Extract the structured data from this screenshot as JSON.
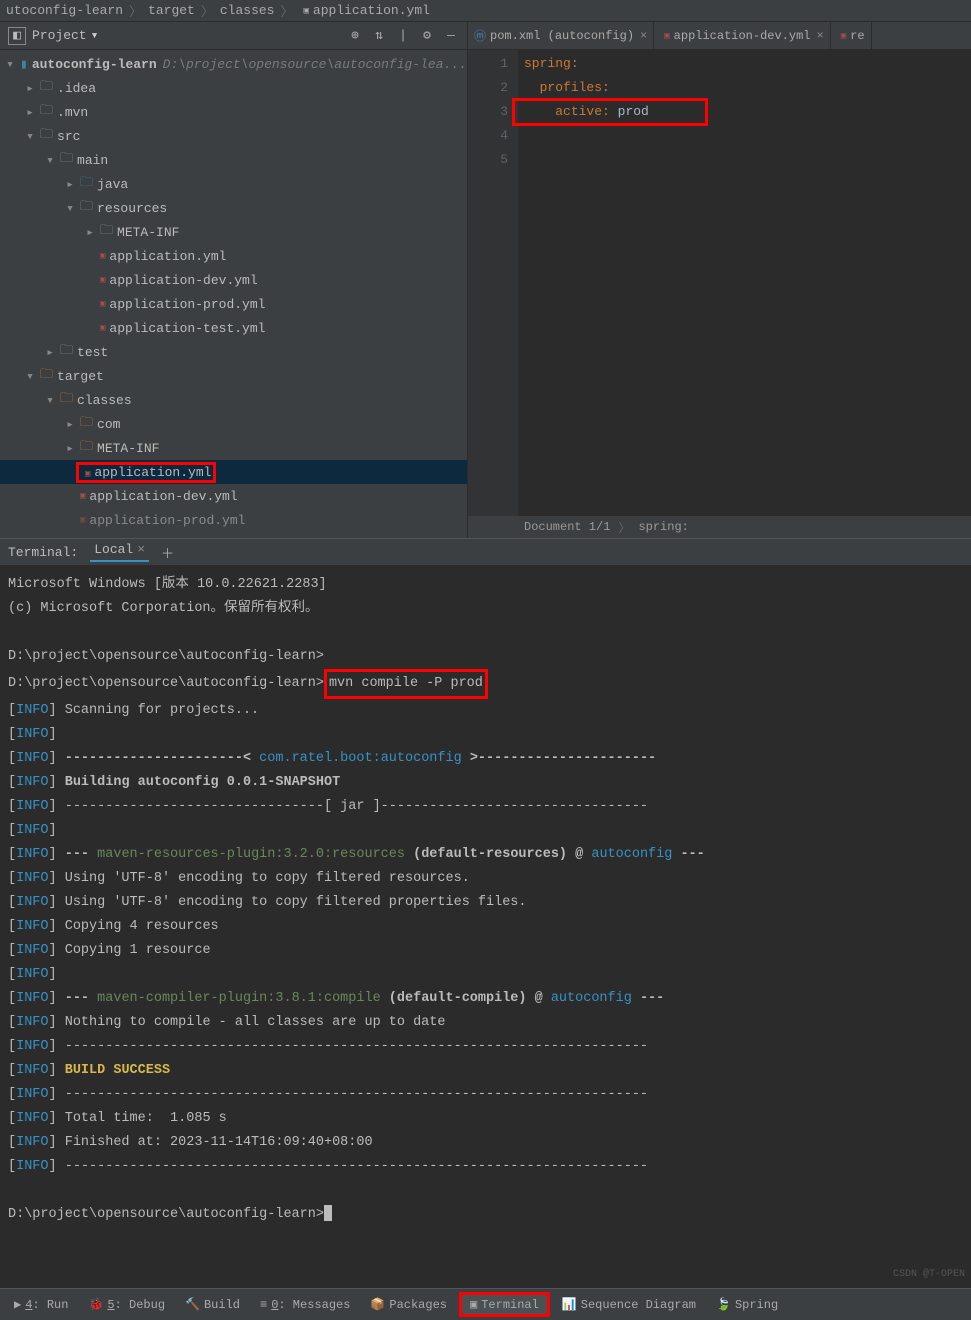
{
  "breadcrumb": {
    "items": [
      "utoconfig-learn",
      "target",
      "classes",
      "application.yml"
    ]
  },
  "project": {
    "title": "Project",
    "root": {
      "name": "autoconfig-learn",
      "path": "D:\\project\\opensource\\autoconfig-lea..."
    },
    "tree": {
      "idea": ".idea",
      "mvn": ".mvn",
      "src": "src",
      "main": "main",
      "java": "java",
      "resources": "resources",
      "metainf": "META-INF",
      "appyml": "application.yml",
      "appdev": "application-dev.yml",
      "appprod": "application-prod.yml",
      "apptest": "application-test.yml",
      "test": "test",
      "target": "target",
      "classes": "classes",
      "com": "com",
      "metainf2": "META-INF",
      "t_appyml": "application.yml",
      "t_appdev": "application-dev.yml",
      "t_appprod": "application-prod.yml"
    }
  },
  "tabs": [
    {
      "label": "pom.xml (autoconfig)",
      "icon": "m"
    },
    {
      "label": "application-dev.yml",
      "icon": "yml"
    },
    {
      "label": "re",
      "icon": "yml"
    }
  ],
  "editor": {
    "lines": [
      "spring:",
      "  profiles:",
      "    active: prod",
      "",
      ""
    ],
    "status_doc": "Document 1/1",
    "status_path": "spring:"
  },
  "terminal": {
    "title": "Terminal:",
    "tab": "Local",
    "lines": [
      {
        "t": "plain",
        "text": "Microsoft Windows [版本 10.0.22621.2283]"
      },
      {
        "t": "plain",
        "text": "(c) Microsoft Corporation。保留所有权利。"
      },
      {
        "t": "blank"
      },
      {
        "t": "plain",
        "text": "D:\\project\\opensource\\autoconfig-learn>"
      },
      {
        "t": "cmd",
        "prompt": "D:\\project\\opensource\\autoconfig-learn>",
        "cmd": "mvn compile -P prod"
      },
      {
        "t": "info",
        "text": "Scanning for projects..."
      },
      {
        "t": "info",
        "text": ""
      },
      {
        "t": "info-mid",
        "pre": "----------------------< ",
        "mid": "com.ratel.boot:autoconfig",
        "post": " >----------------------"
      },
      {
        "t": "info-bold",
        "text": "Building autoconfig 0.0.1-SNAPSHOT"
      },
      {
        "t": "info",
        "text": "--------------------------------[ jar ]---------------------------------"
      },
      {
        "t": "info",
        "text": ""
      },
      {
        "t": "info-plugin",
        "pre": "--- ",
        "plugin": "maven-resources-plugin:3.2.0:resources",
        "mid2": " (default-resources) @ ",
        "proj": "autoconfig",
        "post": " ---"
      },
      {
        "t": "info",
        "text": "Using 'UTF-8' encoding to copy filtered resources."
      },
      {
        "t": "info",
        "text": "Using 'UTF-8' encoding to copy filtered properties files."
      },
      {
        "t": "info",
        "text": "Copying 4 resources"
      },
      {
        "t": "info",
        "text": "Copying 1 resource"
      },
      {
        "t": "info",
        "text": ""
      },
      {
        "t": "info-plugin",
        "pre": "--- ",
        "plugin": "maven-compiler-plugin:3.8.1:compile",
        "mid2": " (default-compile) @ ",
        "proj": "autoconfig",
        "post": " ---"
      },
      {
        "t": "info",
        "text": "Nothing to compile - all classes are up to date"
      },
      {
        "t": "info",
        "text": "------------------------------------------------------------------------"
      },
      {
        "t": "info-success",
        "text": "BUILD SUCCESS"
      },
      {
        "t": "info",
        "text": "------------------------------------------------------------------------"
      },
      {
        "t": "info",
        "text": "Total time:  1.085 s"
      },
      {
        "t": "info",
        "text": "Finished at: 2023-11-14T16:09:40+08:00"
      },
      {
        "t": "info",
        "text": "------------------------------------------------------------------------"
      },
      {
        "t": "blank"
      },
      {
        "t": "prompt-cursor",
        "text": "D:\\project\\opensource\\autoconfig-learn>"
      }
    ]
  },
  "bottombar": {
    "items": [
      {
        "label": "4: Run",
        "icon": "▶"
      },
      {
        "label": "5: Debug",
        "icon": "🐞"
      },
      {
        "label": "Build",
        "icon": "🔨"
      },
      {
        "label": "0: Messages",
        "icon": "≡"
      },
      {
        "label": "Packages",
        "icon": "📦"
      },
      {
        "label": "Terminal",
        "icon": "▣",
        "active": true,
        "red": true
      },
      {
        "label": "Sequence Diagram",
        "icon": "📊"
      },
      {
        "label": "Spring",
        "icon": "🍃"
      }
    ]
  },
  "watermark": "CSDN @T-OPEN"
}
